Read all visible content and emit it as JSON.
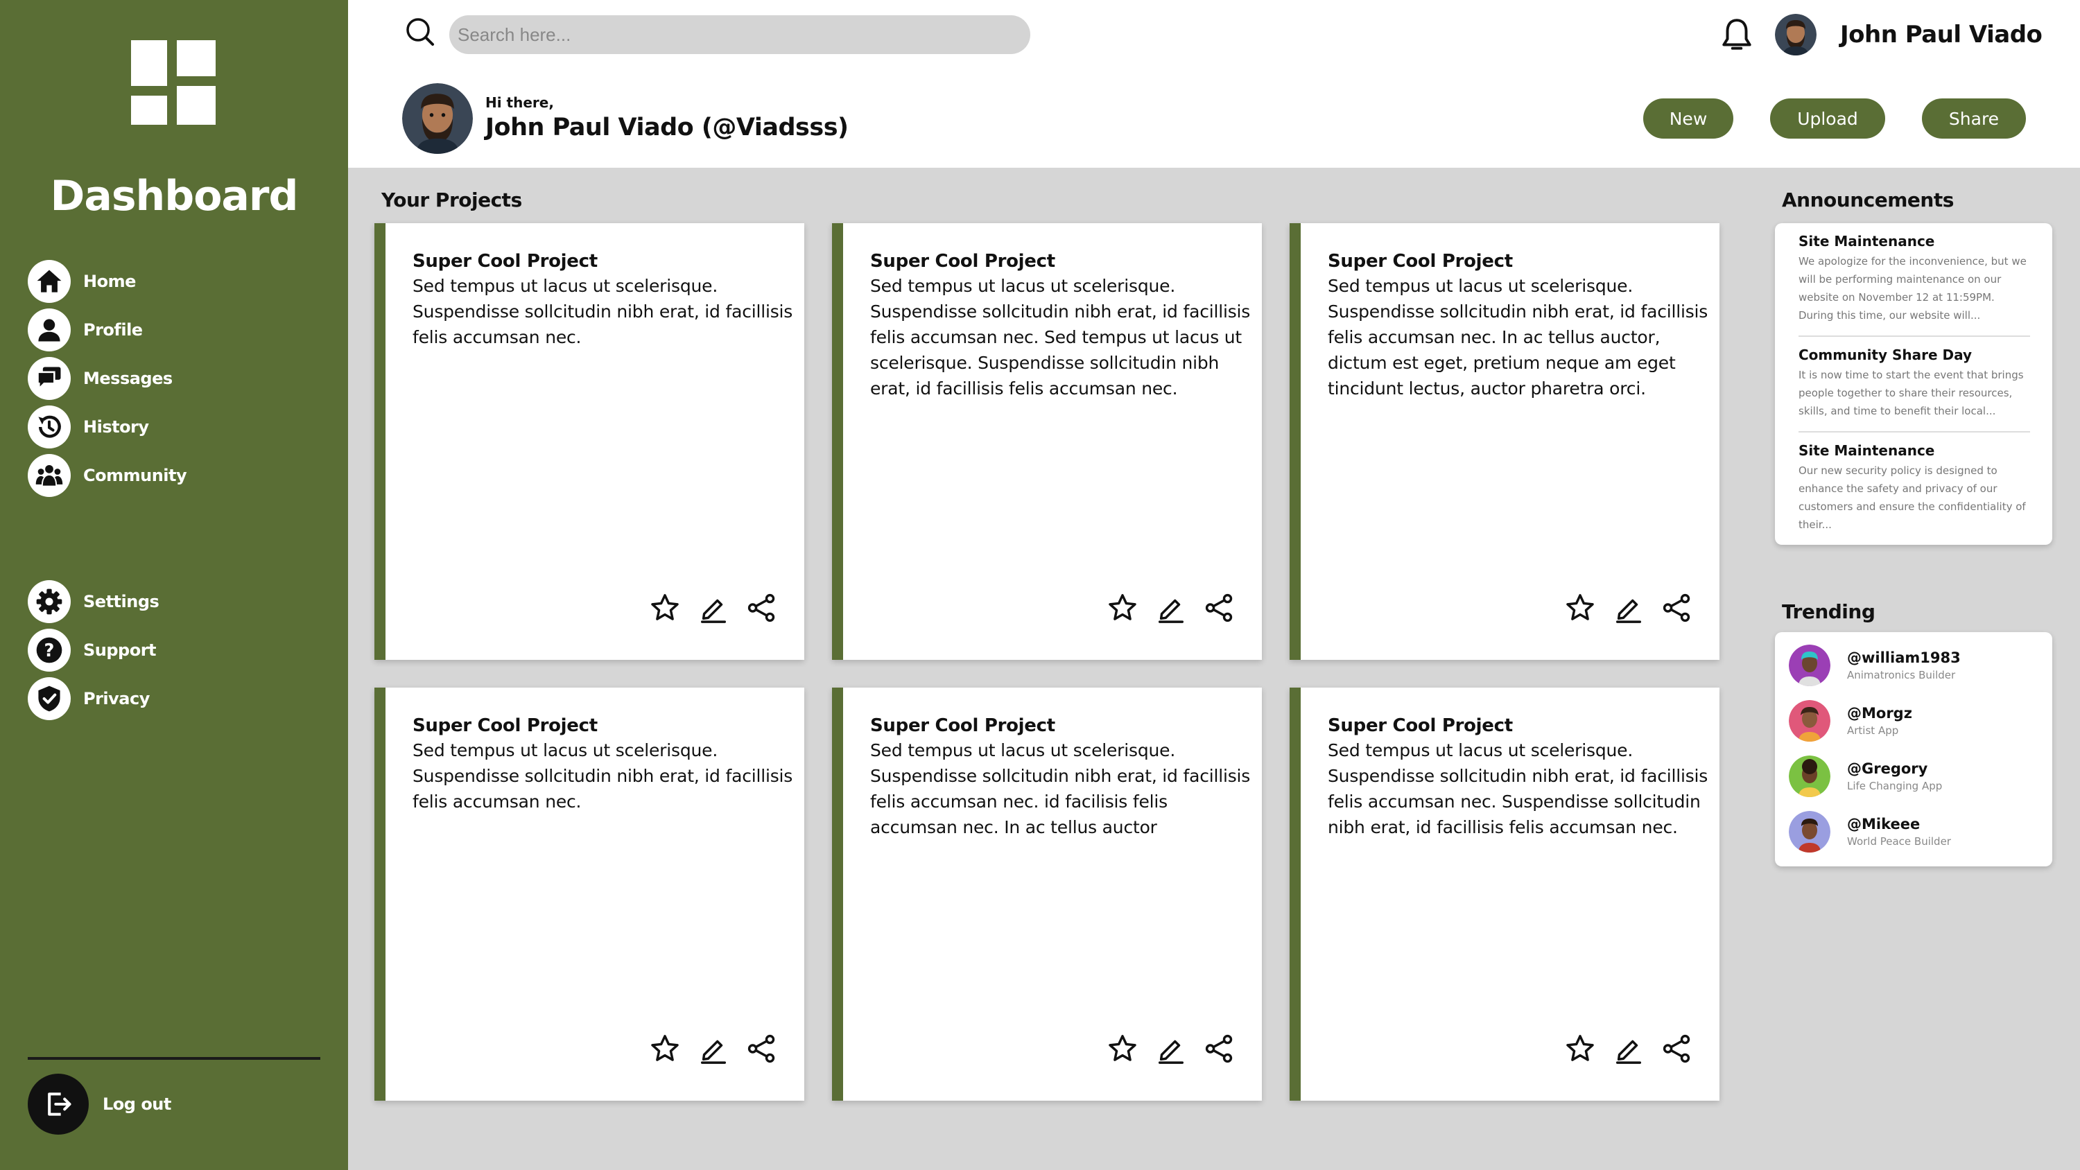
{
  "sidebar": {
    "title": "Dashboard",
    "nav": [
      {
        "label": "Home",
        "icon": "home-icon"
      },
      {
        "label": "Profile",
        "icon": "profile-icon"
      },
      {
        "label": "Messages",
        "icon": "messages-icon"
      },
      {
        "label": "History",
        "icon": "history-icon"
      },
      {
        "label": "Community",
        "icon": "community-icon"
      },
      {
        "label": "Settings",
        "icon": "settings-icon"
      },
      {
        "label": "Support",
        "icon": "support-icon"
      },
      {
        "label": "Privacy",
        "icon": "privacy-icon"
      }
    ],
    "logout_label": "Log out"
  },
  "header": {
    "search_placeholder": "Search here...",
    "user_name": "John Paul Viado",
    "greeting": "Hi there,",
    "handle": "John Paul Viado (@Viadsss)",
    "buttons": {
      "new": "New",
      "upload": "Upload",
      "share": "Share"
    }
  },
  "projects": {
    "title": "Your Projects",
    "cards": [
      {
        "title": "Super Cool Project",
        "desc": "Sed tempus ut lacus ut scelerisque. Suspendisse sollcitudin nibh erat, id facillisis felis accumsan nec."
      },
      {
        "title": "Super Cool Project",
        "desc": "Sed tempus ut lacus ut scelerisque. Suspendisse sollcitudin nibh erat, id facillisis felis accumsan nec. Sed tempus ut lacus ut scelerisque. Suspendisse sollcitudin nibh erat, id facillisis felis accumsan nec."
      },
      {
        "title": "Super Cool Project",
        "desc": "Sed tempus ut lacus ut scelerisque. Suspendisse sollcitudin nibh erat, id facillisis felis accumsan nec. In ac tellus auctor, dictum est eget, pretium neque am eget tincidunt lectus, auctor pharetra orci."
      },
      {
        "title": "Super Cool Project",
        "desc": "Sed tempus ut lacus ut scelerisque. Suspendisse sollcitudin nibh erat, id facillisis felis accumsan nec."
      },
      {
        "title": "Super Cool Project",
        "desc": "Sed tempus ut lacus ut scelerisque. Suspendisse sollcitudin nibh erat, id facillisis felis accumsan nec. id facilisis felis accumsan nec. In ac tellus auctor"
      },
      {
        "title": "Super Cool Project",
        "desc": "Sed tempus ut lacus ut scelerisque. Suspendisse sollcitudin nibh erat, id facillisis felis accumsan nec. Suspendisse sollcitudin nibh erat, id facillisis felis accumsan nec."
      }
    ]
  },
  "announcements": {
    "title": "Announcements",
    "items": [
      {
        "title": "Site Maintenance",
        "body": "We apologize for the inconvenience, but we will be performing maintenance on our website on November 12 at 11:59PM. During this time, our website will..."
      },
      {
        "title": "Community Share Day",
        "body": "It is now time to start the event that brings people together to share their resources, skills, and time to benefit their local..."
      },
      {
        "title": "Site Maintenance",
        "body": "Our new security policy is designed to enhance the safety and privacy of our customers and ensure the confidentiality of their..."
      }
    ]
  },
  "trending": {
    "title": "Trending",
    "items": [
      {
        "user": "@william1983",
        "sub": "Animatronics Builder",
        "color": "#9b3fb5"
      },
      {
        "user": "@Morgz",
        "sub": "Artist App",
        "color": "#e0587a"
      },
      {
        "user": "@Gregory",
        "sub": "Life Changing App",
        "color": "#7bc142"
      },
      {
        "user": "@Mikeee",
        "sub": "World Peace Builder",
        "color": "#9a9ee0"
      }
    ]
  },
  "colors": {
    "accent": "#5a6e35",
    "background": "#d6d6d6"
  }
}
